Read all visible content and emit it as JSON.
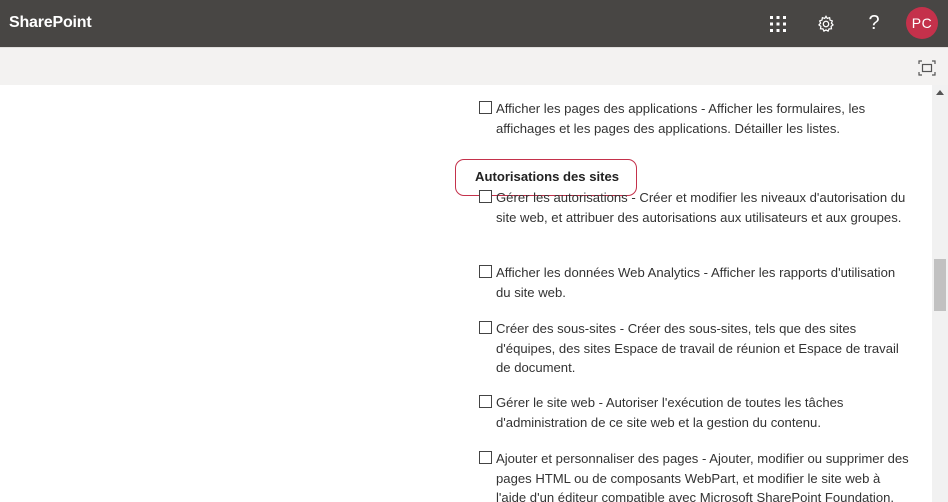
{
  "suite_bar": {
    "brand": "SharePoint",
    "help_label": "?",
    "avatar_initials": "PC",
    "avatar_color": "#c4314b",
    "bar_color": "#484644",
    "icons": [
      "app-launcher-icon",
      "settings-gear-icon",
      "help-icon"
    ]
  },
  "command_bar": {
    "focus_icon": "focus-mode-icon"
  },
  "permissions": {
    "item_apps": "Afficher les pages des applications  -  Afficher les formulaires, les affichages et les pages des applications. Détailler les listes.",
    "section_title": "Autorisations des sites",
    "items": [
      {
        "label": "Gérer les autorisations  -  Créer et modifier les niveaux d'autorisation du site web, et attribuer des autorisations aux utilisateurs et aux groupes."
      },
      {
        "label": "Afficher les données Web Analytics  -  Afficher les rapports d'utilisation du site web."
      },
      {
        "label": "Créer des sous-sites  -  Créer des sous-sites, tels que des sites d'équipes, des sites Espace de travail de réunion et Espace de travail de document."
      },
      {
        "label": "Gérer le site web  -  Autoriser l'exécution de toutes les tâches d'administration de ce site web et la gestion du contenu."
      },
      {
        "label": "Ajouter et personnaliser des pages  -  Ajouter, modifier ou supprimer des pages HTML ou de composants WebPart, et modifier le site web à l'aide d'un éditeur compatible avec Microsoft SharePoint Foundation."
      }
    ]
  }
}
